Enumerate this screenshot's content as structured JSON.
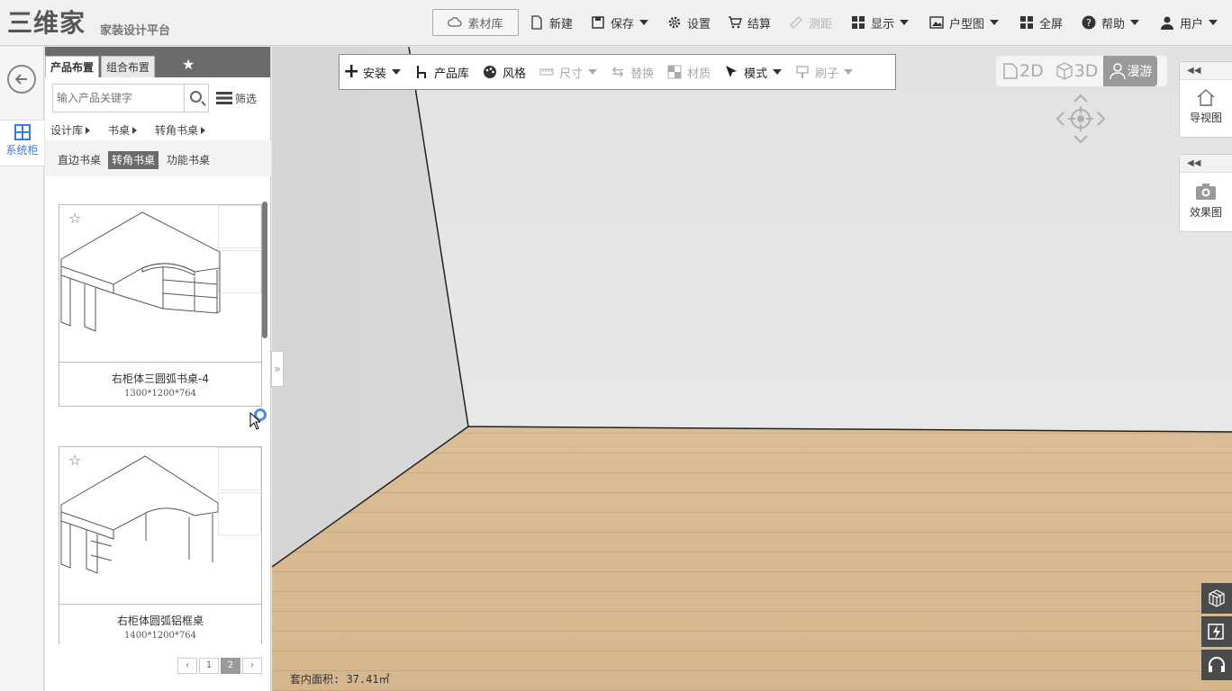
{
  "header": {
    "logo_text": "三维家",
    "tagline": "家装设计平台",
    "material_lib": "素材库",
    "menu": [
      {
        "label": "新建",
        "icon": "file-icon"
      },
      {
        "label": "保存",
        "icon": "save-icon"
      },
      {
        "label": "设置",
        "icon": "gear-icon"
      },
      {
        "label": "结算",
        "icon": "cart-icon"
      },
      {
        "label": "测距",
        "icon": "ruler-icon",
        "disabled": true
      },
      {
        "label": "显示",
        "icon": "grid-icon"
      },
      {
        "label": "户型图",
        "icon": "image-icon"
      },
      {
        "label": "全屏",
        "icon": "fullscreen-icon"
      },
      {
        "label": "帮助",
        "icon": "help-icon"
      },
      {
        "label": "用户",
        "icon": "user-icon"
      }
    ]
  },
  "sidebar": {
    "system_cabinet": "系统柜"
  },
  "panel": {
    "tabs": [
      "产品布置",
      "组合布置"
    ],
    "search_placeholder": "输入产品关键字",
    "filter_label": "筛选",
    "breadcrumbs": [
      "设计库",
      "书桌",
      "转角书桌"
    ],
    "categories": [
      {
        "label": "直边书桌",
        "active": false
      },
      {
        "label": "转角书桌",
        "active": true
      },
      {
        "label": "功能书桌",
        "active": false
      }
    ],
    "products": [
      {
        "name": "右柜体三圆弧书桌-4",
        "dims": "1300*1200*764"
      },
      {
        "name": "右柜体圆弧铝框桌",
        "dims": "1400*1200*764"
      }
    ],
    "pagination": {
      "prev": "‹",
      "pages": [
        "1",
        "2"
      ],
      "current": "2",
      "next": "›"
    }
  },
  "toolbar": {
    "tools": [
      {
        "label": "安装",
        "dropdown": true,
        "disabled": false,
        "icon": "plus-icon"
      },
      {
        "label": "产品库",
        "dropdown": false,
        "disabled": false,
        "icon": "chair-icon"
      },
      {
        "label": "风格",
        "dropdown": false,
        "disabled": false,
        "icon": "palette-icon"
      },
      {
        "label": "尺寸",
        "dropdown": true,
        "disabled": true,
        "icon": "ruler-icon"
      },
      {
        "label": "替换",
        "dropdown": false,
        "disabled": true,
        "icon": "swap-icon"
      },
      {
        "label": "材质",
        "dropdown": false,
        "disabled": true,
        "icon": "texture-icon"
      },
      {
        "label": "模式",
        "dropdown": true,
        "disabled": false,
        "icon": "cursor-icon"
      },
      {
        "label": "刷子",
        "dropdown": true,
        "disabled": true,
        "icon": "brush-icon"
      }
    ]
  },
  "view_switch": {
    "options": [
      "2D",
      "3D",
      "漫游"
    ],
    "active": "漫游"
  },
  "side_panels": {
    "nav_view": "导视图",
    "render_view": "效果图"
  },
  "status": {
    "area": "套内面积: 37.41㎡"
  },
  "colors": {
    "accent": "#3a7bd5",
    "dark_header": "#6b6b6b",
    "floor": "#dcc09a"
  }
}
